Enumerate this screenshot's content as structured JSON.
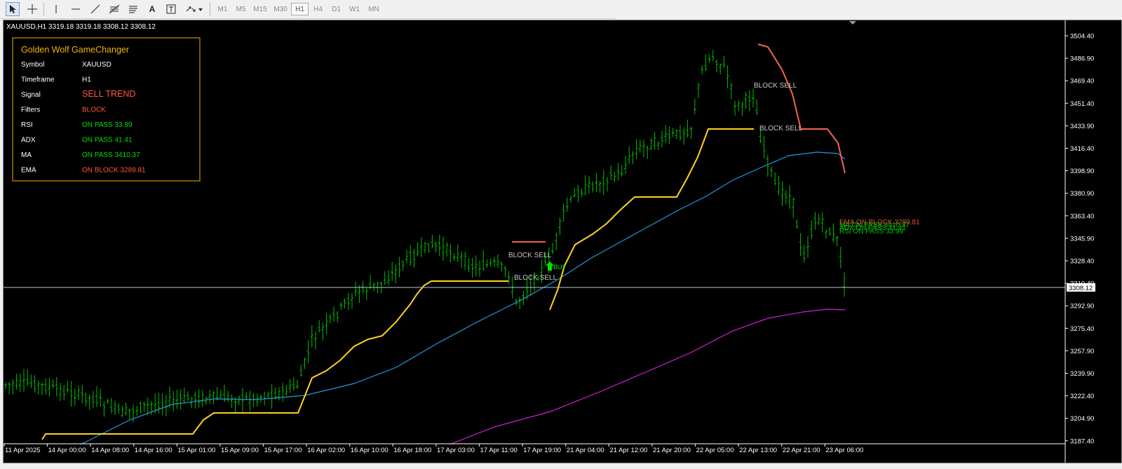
{
  "toolbar": {
    "tools": [
      "cursor-icon",
      "crosshair-icon",
      "vertical-line-icon",
      "horizontal-line-icon",
      "trendline-icon",
      "fibonacci-icon",
      "equidistant-channel-icon",
      "text-icon",
      "text-label-icon",
      "arrows-dropdown-icon"
    ],
    "timeframes": [
      "M1",
      "M5",
      "M15",
      "M30",
      "H1",
      "H4",
      "D1",
      "W1",
      "MN"
    ],
    "active_timeframe": "H1"
  },
  "chart": {
    "header": "XAUUSD,H1  3319.18 3319.18 3308.12 3308.12",
    "current_price_label": "3308.12",
    "y_axis_labels": [
      "3504.40",
      "3486.90",
      "3469.40",
      "3451.40",
      "3433.90",
      "3416.40",
      "3398.90",
      "3380.90",
      "3363.40",
      "3345.90",
      "3328.40",
      "3310.40",
      "3292.90",
      "3275.40",
      "3257.90",
      "3239.90",
      "3222.40",
      "3204.90",
      "3187.40"
    ],
    "x_axis_labels": [
      "11 Apr 2025",
      "14 Apr 00:00",
      "14 Apr 08:00",
      "14 Apr 16:00",
      "15 Apr 01:00",
      "15 Apr 09:00",
      "15 Apr 17:00",
      "16 Apr 02:00",
      "16 Apr 10:00",
      "16 Apr 18:00",
      "17 Apr 03:00",
      "17 Apr 11:00",
      "17 Apr 19:00",
      "21 Apr 04:00",
      "21 Apr 12:00",
      "21 Apr 20:00",
      "22 Apr 05:00",
      "22 Apr 13:00",
      "22 Apr 21:00",
      "23 Apr 06:00"
    ],
    "annotations": [
      {
        "text": "BLOCK SELL",
        "color": "#c8c8c8"
      },
      {
        "text": "BLOCK SELL",
        "color": "#c8c8c8"
      },
      {
        "text": "BLOCK SELL",
        "color": "#c8c8c8"
      },
      {
        "text": "BLOCK SELL",
        "color": "#c8c8c8"
      },
      {
        "text": "BUY",
        "color": "#00e600"
      }
    ],
    "right_labels": [
      {
        "text": "EMA ON BLOCK 3289.81",
        "color": "#e05040"
      },
      {
        "text": "MA ON PASS 3410.37",
        "color": "#00c000"
      },
      {
        "text": "ADX ON PASS 41.41",
        "color": "#00c000"
      },
      {
        "text": "RSI ON PASS 33.99",
        "color": "#00c000"
      }
    ]
  },
  "panel": {
    "title": "Golden Wolf GameChanger",
    "rows": [
      {
        "label": "Symbol",
        "value": "XAUUSD",
        "color": "#ffffff"
      },
      {
        "label": "Timeframe",
        "value": "H1",
        "color": "#ffffff"
      },
      {
        "label": "Signal",
        "value": "SELL TREND",
        "color": "#ff5a3c"
      },
      {
        "label": "Filters",
        "value": "BLOCK",
        "color": "#ff5a3c"
      },
      {
        "label": "RSI",
        "value": "ON PASS 33.99",
        "color": "#00e000"
      },
      {
        "label": "ADX",
        "value": "ON PASS 41.41",
        "color": "#00e000"
      },
      {
        "label": "MA",
        "value": "ON PASS 3410.37",
        "color": "#00e000"
      },
      {
        "label": "EMA",
        "value": "ON BLOCK 3289.81",
        "color": "#ff5a3c"
      }
    ]
  },
  "colors": {
    "background": "#000000",
    "candles": "#00c000",
    "supertrend_up": "#ffd21e",
    "supertrend_down": "#f06450",
    "ma_line": "#1e9be0",
    "ema_line": "#d21ed2",
    "panel_border": "#f0b400",
    "panel_title": "#f0b400",
    "axis_text": "#ffffff",
    "price_line": "#b4c8dc"
  }
}
